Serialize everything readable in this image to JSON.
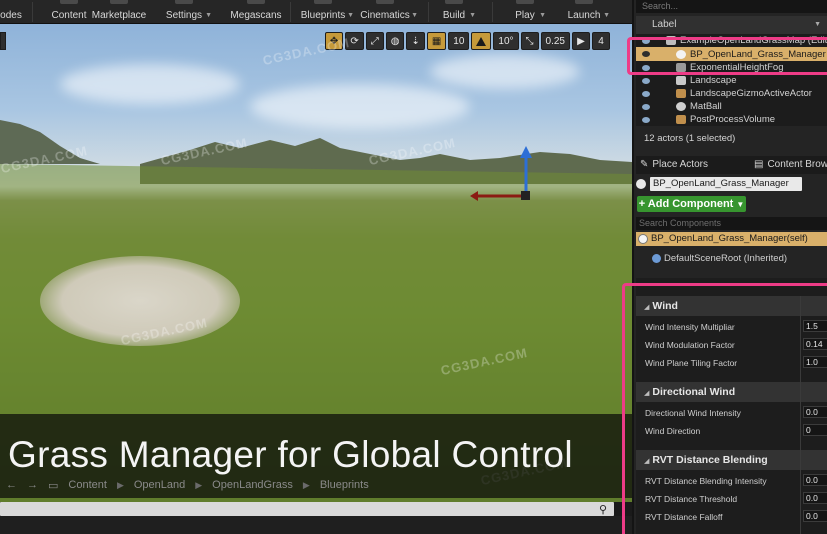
{
  "toolbar": {
    "buttons": [
      "odes",
      "Content",
      "Marketplace",
      "Settings",
      "Megascans",
      "Blueprints",
      "Cinematics",
      "Build",
      "Play",
      "Launch"
    ]
  },
  "viewport": {
    "tools": {
      "grid_snap": "10",
      "rotation_snap": "10°",
      "scale_snap": "0.25",
      "camera_speed": "4"
    },
    "watermark": "CG3DA.COM",
    "title_overlay": "Grass Manager for Global Control"
  },
  "content_browser": {
    "path": [
      "Content",
      "OpenLand",
      "OpenLandGrass",
      "Blueprints"
    ]
  },
  "outliner": {
    "search_placeholder": "Search...",
    "column_label": "Label",
    "rows": [
      "ExampleOpenLandGrassMap (Editor)",
      "BP_OpenLand_Grass_Manager",
      "ExponentialHeightFog",
      "Landscape",
      "LandscapeGizmoActiveActor",
      "MatBall",
      "PostProcessVolume"
    ],
    "selected_index": 1,
    "actor_count": "12 actors (1 selected)"
  },
  "tabs": {
    "place_actors": "Place Actors",
    "content_browser": "Content Browser"
  },
  "details": {
    "actor_name": "BP_OpenLand_Grass_Manager",
    "add_component": "+ Add Component",
    "search_components": "Search Components",
    "self_component": "BP_OpenLand_Grass_Manager(self)",
    "root_component": "DefaultSceneRoot (Inherited)",
    "sections": [
      {
        "name": "Wind",
        "props": [
          {
            "label": "Wind Intensity Multipliar",
            "value": "1.5"
          },
          {
            "label": "Wind Modulation Factor",
            "value": "0.14"
          },
          {
            "label": "Wind Plane Tiling Factor",
            "value": "1.0"
          }
        ]
      },
      {
        "name": "Directional Wind",
        "props": [
          {
            "label": "Directional Wind Intensity",
            "value": "0.0"
          },
          {
            "label": "Wind Direction",
            "value": "0"
          }
        ]
      },
      {
        "name": "RVT Distance Blending",
        "props": [
          {
            "label": "RVT Distance Blending Intensity",
            "value": "0.0"
          },
          {
            "label": "RVT Distance Threshold",
            "value": "0.0"
          },
          {
            "label": "RVT Distance Falloff",
            "value": "0.0"
          }
        ]
      }
    ]
  },
  "colors": {
    "highlight": "#ee3c87",
    "selection": "#d9b06a",
    "add_button": "#37952f"
  }
}
